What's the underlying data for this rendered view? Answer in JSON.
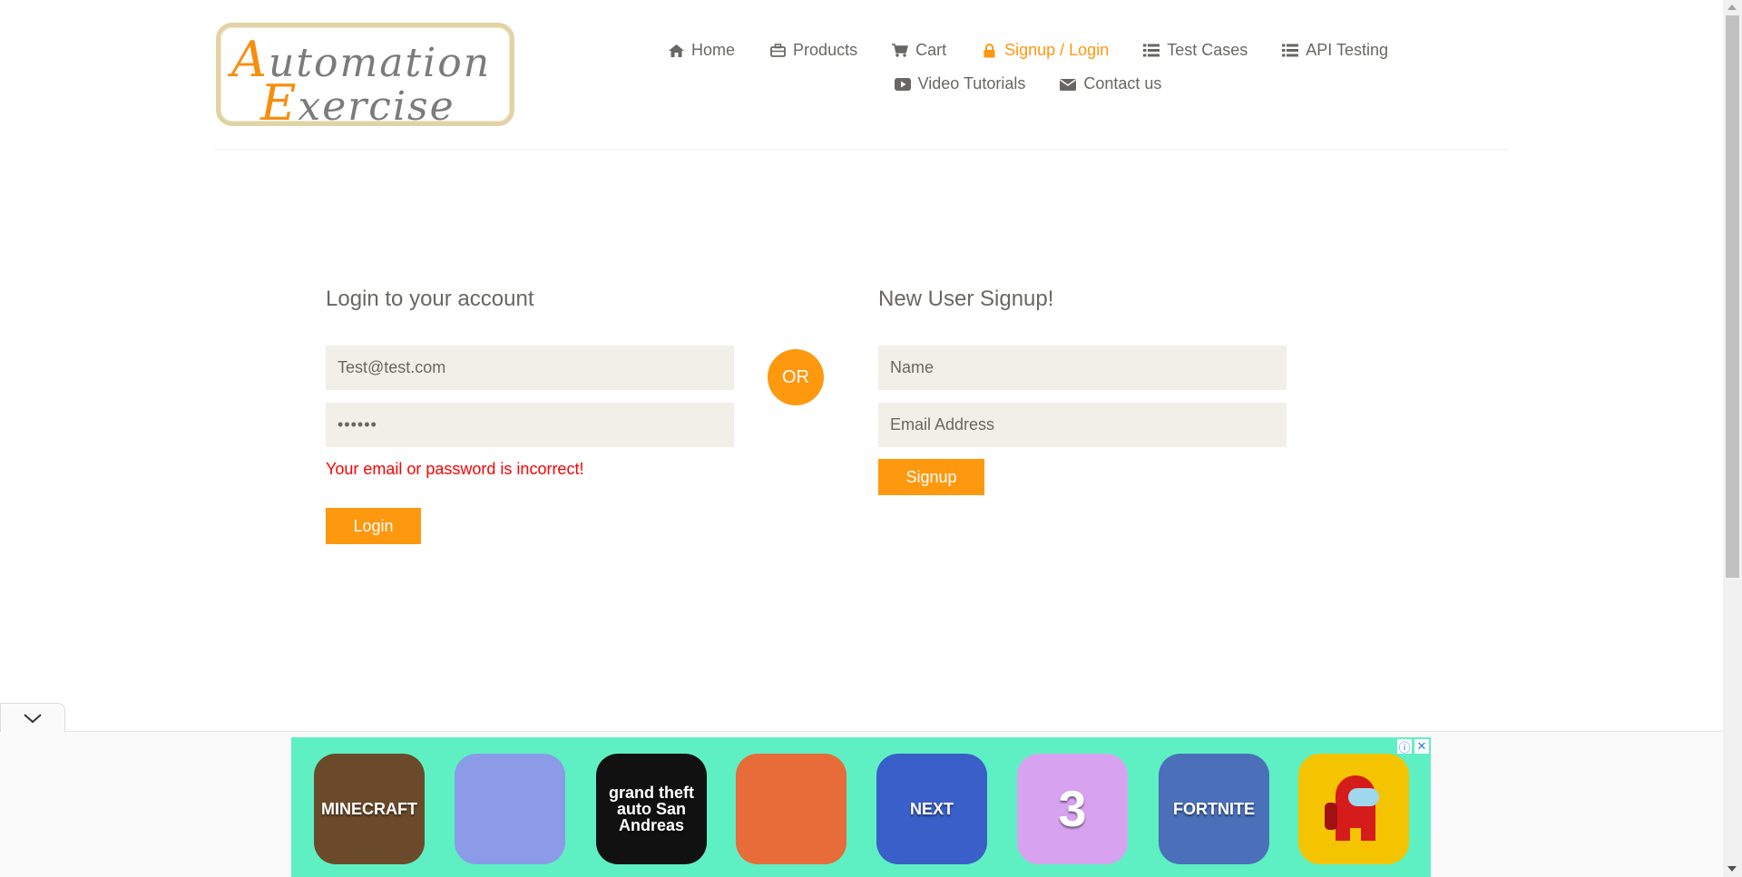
{
  "logo": {
    "line1": "Automation",
    "line2": "Exercise"
  },
  "nav": [
    {
      "label": "Home",
      "icon": "home-icon"
    },
    {
      "label": "Products",
      "icon": "briefcase-icon"
    },
    {
      "label": "Cart",
      "icon": "cart-icon"
    },
    {
      "label": "Signup / Login",
      "icon": "lock-icon",
      "active": true
    },
    {
      "label": "Test Cases",
      "icon": "list-icon"
    },
    {
      "label": "API Testing",
      "icon": "list-icon"
    },
    {
      "label": "Video Tutorials",
      "icon": "youtube-play-icon"
    },
    {
      "label": "Contact us",
      "icon": "envelope-icon"
    }
  ],
  "login": {
    "title": "Login to your account",
    "email_value": "Test@test.com",
    "password_value": "••••••",
    "error": "Your email or password is incorrect!",
    "button": "Login"
  },
  "or_label": "OR",
  "signup": {
    "title": "New User Signup!",
    "name_placeholder": "Name",
    "email_placeholder": "Email Address",
    "button": "Signup"
  },
  "colors": {
    "accent": "#fe980f",
    "error": "#ff0000",
    "input_bg": "#f0f0e9",
    "text": "#696763",
    "ad_bg": "#5ef0c3"
  },
  "ad": {
    "apps": [
      {
        "name": "MINECRAFT",
        "icon": "minecraft-app-icon",
        "bg": "#6b4a2b"
      },
      {
        "name": "",
        "icon": "slither-snake-app-icon",
        "bg": "#8c9be8"
      },
      {
        "name": "grand theft auto San Andreas",
        "icon": "gta-san-andreas-app-icon",
        "bg": "#111111"
      },
      {
        "name": "",
        "icon": "subway-surfers-app-icon",
        "bg": "#e86b3a"
      },
      {
        "name": "NEXT",
        "icon": "mobile-legends-app-icon",
        "bg": "#3a5fc8"
      },
      {
        "name": "3",
        "icon": "piano-tiles-app-icon",
        "bg": "#d7a3f0"
      },
      {
        "name": "FORTNITE",
        "icon": "fortnite-app-icon",
        "bg": "#4b6fb8"
      },
      {
        "name": "",
        "icon": "among-us-app-icon",
        "bg": "#f5c400"
      }
    ]
  }
}
